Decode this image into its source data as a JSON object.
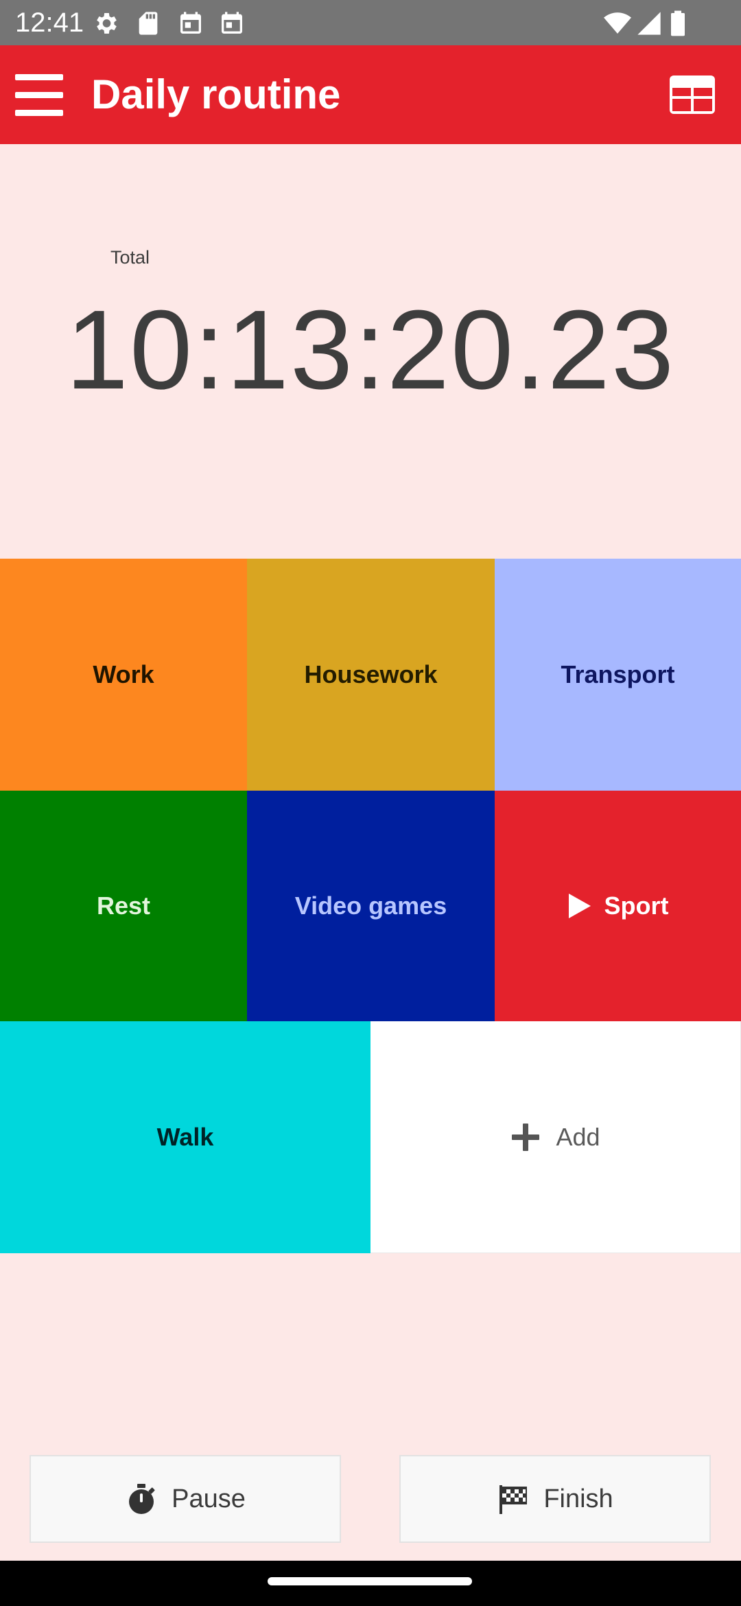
{
  "status_bar": {
    "time": "12:41",
    "icons": [
      "settings-icon",
      "sd-card-icon",
      "calendar-icon",
      "calendar-icon",
      "wifi-icon",
      "cellular-signal-icon",
      "battery-icon"
    ]
  },
  "app_bar": {
    "title": "Daily routine",
    "menu_icon": "hamburger-menu-icon",
    "action_icon": "table-view-icon"
  },
  "timer": {
    "label": "Total",
    "value": "10:13:20.23"
  },
  "activities": [
    {
      "name": "Work",
      "bg_color": "#fd871f",
      "text_color": "#1f1400",
      "active": false
    },
    {
      "name": "Housework",
      "bg_color": "#d9a521",
      "text_color": "#231c00",
      "active": false
    },
    {
      "name": "Transport",
      "bg_color": "#a7b8ff",
      "text_color": "#0e1660",
      "active": false
    },
    {
      "name": "Rest",
      "bg_color": "#008000",
      "text_color": "#e2f5dc",
      "active": false
    },
    {
      "name": "Video games",
      "bg_color": "#001f9e",
      "text_color": "#b7c6ff",
      "active": false
    },
    {
      "name": "Sport",
      "bg_color": "#e4222c",
      "text_color": "#ffffff",
      "active": true
    },
    {
      "name": "Walk",
      "bg_color": "#00d7dc",
      "text_color": "#002326",
      "active": false
    }
  ],
  "add_tile": {
    "label": "Add",
    "icon": "plus-icon"
  },
  "buttons": {
    "pause": {
      "label": "Pause",
      "icon": "stopwatch-icon"
    },
    "finish": {
      "label": "Finish",
      "icon": "checkered-flag-icon"
    }
  },
  "colors": {
    "app_bar": "#e4222c",
    "background": "#fde8e7",
    "status_bar": "#757575"
  }
}
